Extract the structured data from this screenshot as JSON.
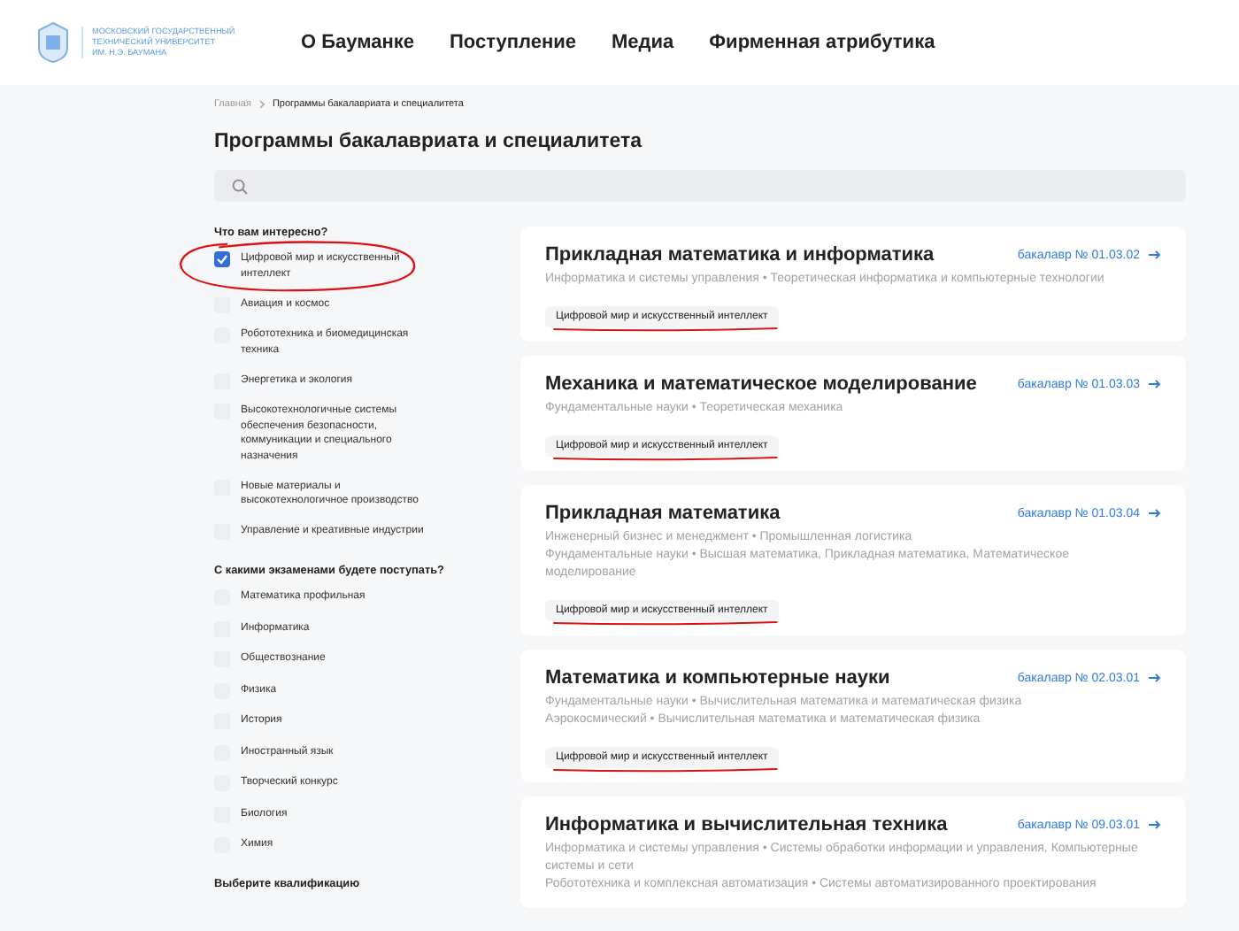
{
  "logo": {
    "lines": [
      "МОСКОВСКИЙ ГОСУДАРСТВЕННЫЙ",
      "ТЕХНИЧЕСКИЙ УНИВЕРСИТЕТ",
      "ИМ. Н.Э. БАУМАНА"
    ]
  },
  "nav": [
    "О Бауманке",
    "Поступление",
    "Медиа",
    "Фирменная атрибутика"
  ],
  "breadcrumbs": [
    "Главная",
    "Программы бакалавриата и специалитета"
  ],
  "page_title": "Программы бакалавриата и специалитета",
  "filters": [
    {
      "heading": "Что вам интересно?",
      "items": [
        {
          "label": "Цифровой мир и искусственный интеллект",
          "checked": true,
          "circled": true
        },
        {
          "label": "Авиация и космос",
          "checked": false,
          "circled": false
        },
        {
          "label": "Робототехника и биомедицинская техника",
          "checked": false,
          "circled": false
        },
        {
          "label": "Энергетика и экология",
          "checked": false,
          "circled": false
        },
        {
          "label": "Высокотехнологичные системы обеспечения безопасности, коммуникации и специального назначения",
          "checked": false,
          "circled": false
        },
        {
          "label": "Новые материалы и высокотехнологичное производство",
          "checked": false,
          "circled": false
        },
        {
          "label": "Управление и креативные индустрии",
          "checked": false,
          "circled": false
        }
      ]
    },
    {
      "heading": "С какими экзаменами будете поступать?",
      "items": [
        {
          "label": "Математика профильная",
          "checked": false,
          "circled": false
        },
        {
          "label": "Информатика",
          "checked": false,
          "circled": false
        },
        {
          "label": "Обществознание",
          "checked": false,
          "circled": false
        },
        {
          "label": "Физика",
          "checked": false,
          "circled": false
        },
        {
          "label": "История",
          "checked": false,
          "circled": false
        },
        {
          "label": "Иностранный язык",
          "checked": false,
          "circled": false
        },
        {
          "label": "Творческий конкурс",
          "checked": false,
          "circled": false
        },
        {
          "label": "Биология",
          "checked": false,
          "circled": false
        },
        {
          "label": "Химия",
          "checked": false,
          "circled": false
        }
      ]
    },
    {
      "heading": "Выберите квалификацию"
    }
  ],
  "programs": [
    {
      "title": "Прикладная математика и информатика",
      "code": "бакалавр № 01.03.02",
      "details": [
        "Информатика и системы управления • Теоретическая информатика и компьютерные технологии"
      ],
      "tag": "Цифровой мир и искусственный интеллект",
      "tag_underlined": true
    },
    {
      "title": "Механика и математическое моделирование",
      "code": "бакалавр № 01.03.03",
      "details": [
        "Фундаментальные науки • Теоретическая механика"
      ],
      "tag": "Цифровой мир и искусственный интеллект",
      "tag_underlined": true
    },
    {
      "title": "Прикладная математика",
      "code": "бакалавр № 01.03.04",
      "details": [
        "Инженерный бизнес и менеджмент • Промышленная логистика",
        "Фундаментальные науки • Высшая математика, Прикладная математика, Математическое моделирование"
      ],
      "tag": "Цифровой мир и искусственный интеллект",
      "tag_underlined": true
    },
    {
      "title": "Математика и компьютерные науки",
      "code": "бакалавр № 02.03.01",
      "details": [
        "Фундаментальные науки • Вычислительная математика и математическая физика",
        "Аэрокосмический • Вычислительная математика и математическая физика"
      ],
      "tag": "Цифровой мир и искусственный интеллект",
      "tag_underlined": true
    },
    {
      "title": "Информатика и вычислительная техника",
      "code": "бакалавр № 09.03.01",
      "details": [
        "Информатика и системы управления • Системы обработки информации и управления, Компьютерные системы и сети",
        "Робототехника и комплексная автоматизация • Системы автоматизированного проектирования"
      ]
    }
  ]
}
